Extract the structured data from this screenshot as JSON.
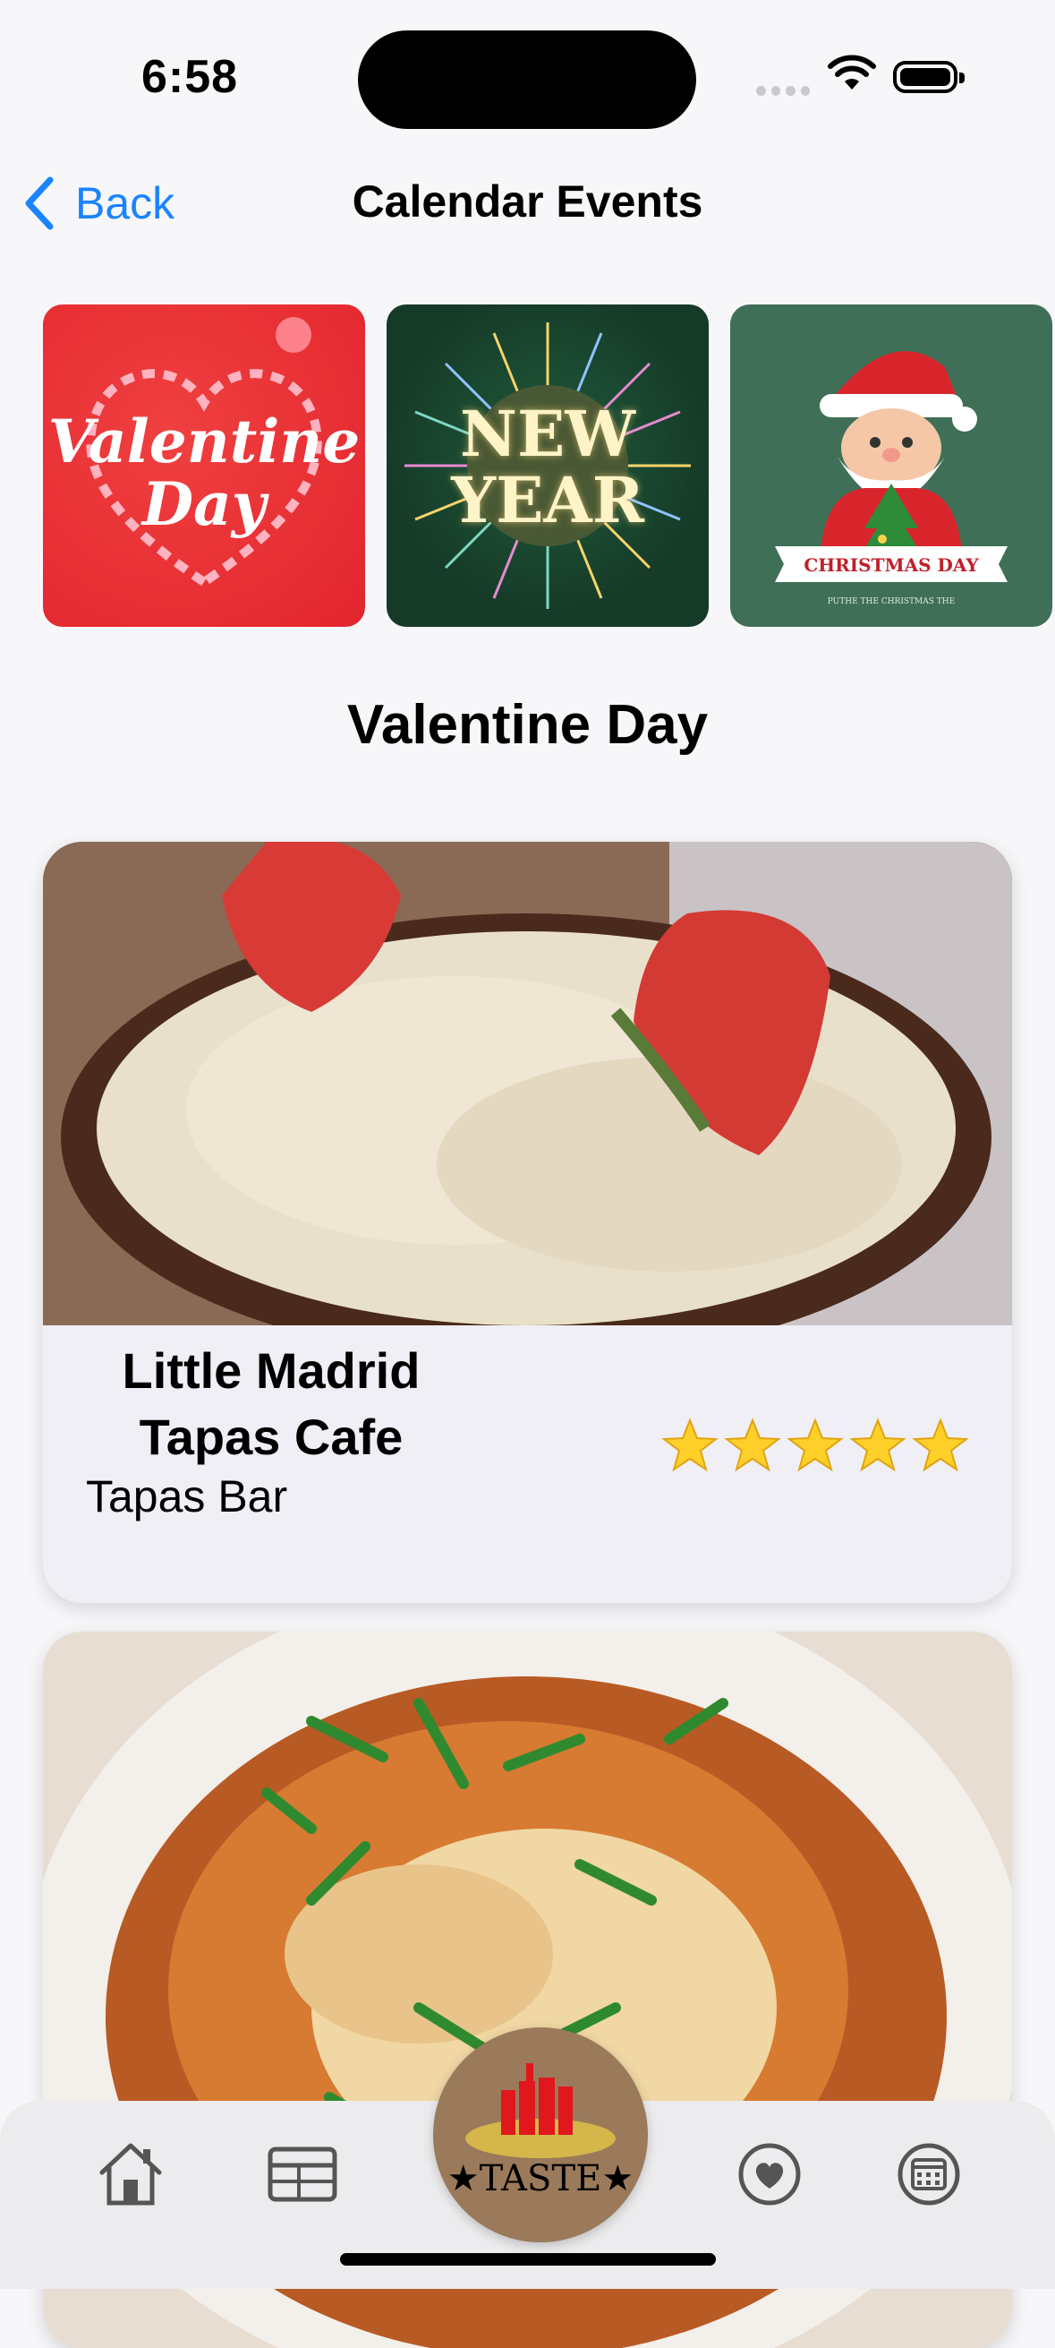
{
  "status_bar": {
    "time": "6:58"
  },
  "nav": {
    "back_label": "Back",
    "title": "Calendar Events"
  },
  "events": [
    {
      "name": "Valentine Day",
      "line1": "Valentine",
      "line2": "Day"
    },
    {
      "name": "New Year",
      "line1": "NEW",
      "line2": "YEAR"
    },
    {
      "name": "Christmas Day",
      "banner": "CHRISTMAS DAY",
      "sub": "PUTHE THE CHRISTMAS THE"
    }
  ],
  "section_title": "Valentine Day",
  "restaurants": [
    {
      "name_line1": "Little Madrid",
      "name_line2": "Tapas Cafe",
      "type": "Tapas Bar",
      "rating": 5
    },
    {
      "name_line1": "",
      "name_line2": "",
      "type": "",
      "rating": null
    }
  ],
  "tab_bar": {
    "items": [
      "home-icon",
      "menu-grid-icon",
      "taste-logo",
      "favorites-icon",
      "calendar-icon"
    ],
    "taste_label": "★TASTE★"
  },
  "colors": {
    "accent": "#1a84ff",
    "tile_red": "#e2252d",
    "tile_dark_green": "#163a28",
    "tile_green": "#3f7057",
    "taste_bg": "#9a7a5b"
  }
}
